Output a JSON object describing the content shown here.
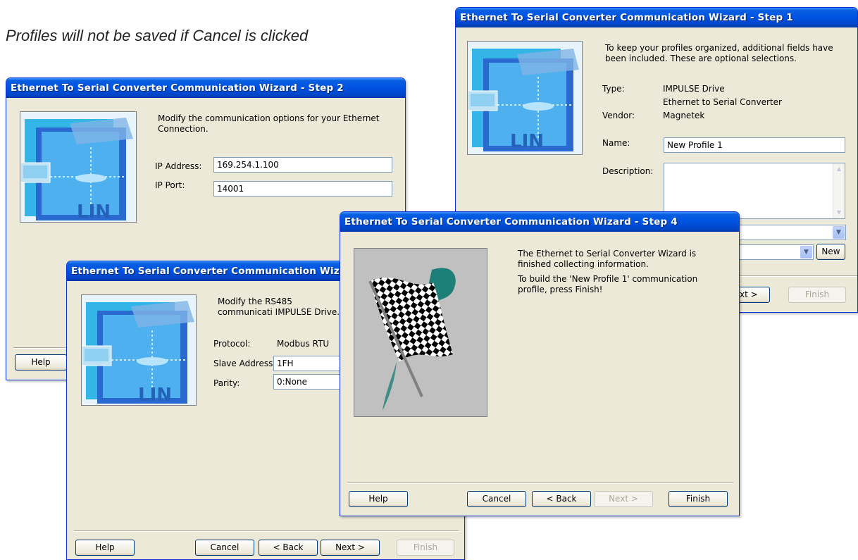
{
  "caption": "Profiles will not be saved if Cancel is clicked",
  "step1": {
    "title": "Ethernet To Serial Converter Communication Wizard - Step 1",
    "intro": "To keep your profiles organized, additional fields have been included. These are optional selections.",
    "type_label": "Type:",
    "type_value_1": "IMPULSE Drive",
    "type_value_2": "Ethernet to Serial Converter",
    "vendor_label": "Vendor:",
    "vendor_value": "Magnetek",
    "name_label": "Name:",
    "name_value": "New Profile 1",
    "description_label": "Description:",
    "description_value": "",
    "new_button": "New",
    "next_button": "xt >",
    "finish_button": "Finish"
  },
  "step2": {
    "title": "Ethernet To Serial Converter Communication Wizard - Step 2",
    "intro": "Modify the communication options for your Ethernet Connection.",
    "ip_label": "IP Address:",
    "ip_value": "169.254.1.100",
    "port_label": "IP Port:",
    "port_value": "14001",
    "help_button": "Help"
  },
  "step3": {
    "title": "Ethernet To Serial Converter Communication Wizard",
    "intro": "Modify the RS485 communicati IMPULSE Drive.",
    "protocol_label": "Protocol:",
    "protocol_value": "Modbus RTU",
    "slave_label": "Slave Address:",
    "slave_value": "1FH",
    "parity_label": "Parity:",
    "parity_value": "0:None",
    "help_button": "Help",
    "cancel_button": "Cancel",
    "back_button": "< Back",
    "next_button": "Next >",
    "finish_button": "Finish"
  },
  "step4": {
    "title": "Ethernet To Serial Converter Communication Wizard - Step 4",
    "line1": "The Ethernet to Serial Converter Wizard is finished collecting information.",
    "line2": "To build the 'New Profile 1' communication profile, press Finish!",
    "help_button": "Help",
    "cancel_button": "Cancel",
    "back_button": "< Back",
    "next_button": "Next >",
    "finish_button": "Finish"
  },
  "icons": {
    "network": "network-illustration-icon",
    "flag": "checkered-flag-icon",
    "combo": "chevron-down-icon"
  },
  "colors": {
    "titlebar": "#0054e3",
    "dialog_bg": "#ece9d8",
    "input_border": "#7f9db9"
  }
}
